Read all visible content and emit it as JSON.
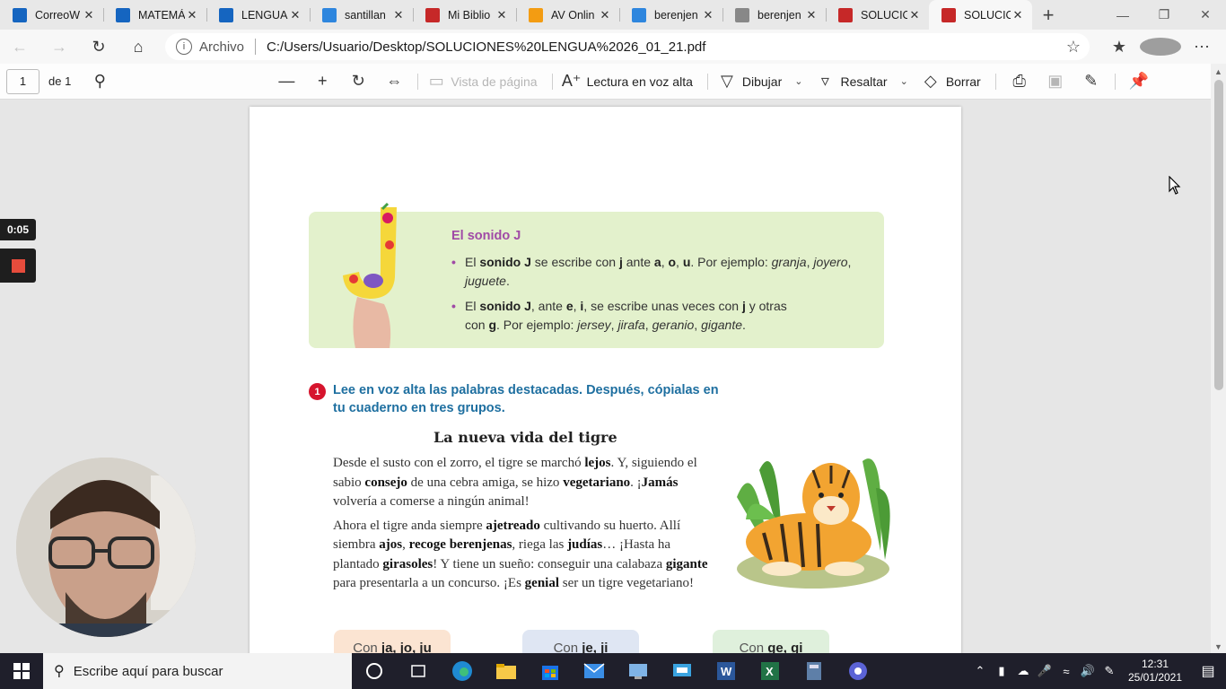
{
  "browser": {
    "tabs": [
      {
        "label": "CorreoW",
        "favicon": "mail-icon",
        "color": "#1565c0",
        "active": false
      },
      {
        "label": "MATEMÁ",
        "favicon": "book-icon",
        "color": "#1565c0",
        "active": false
      },
      {
        "label": "LENGUA",
        "favicon": "book-icon",
        "color": "#1565c0",
        "active": false
      },
      {
        "label": "santillan",
        "favicon": "bing-icon",
        "color": "#2e86de",
        "active": false
      },
      {
        "label": "Mi Biblio",
        "favicon": "e-icon",
        "color": "#c62828",
        "active": false
      },
      {
        "label": "AV Onlin",
        "favicon": "play-icon",
        "color": "#f39c12",
        "active": false
      },
      {
        "label": "berenjen",
        "favicon": "bing-icon",
        "color": "#2e86de",
        "active": false
      },
      {
        "label": "berenjen",
        "favicon": "y-icon",
        "color": "#888888",
        "active": false
      },
      {
        "label": "SOLUCIO",
        "favicon": "pdf-icon",
        "color": "#c62828",
        "active": false
      },
      {
        "label": "SOLUCIO",
        "favicon": "pdf-icon",
        "color": "#c62828",
        "active": true
      }
    ],
    "new_tab_symbol": "+",
    "address": {
      "scheme_label": "Archivo",
      "url": "C:/Users/Usuario/Desktop/SOLUCIONES%20LENGUA%2026_01_21.pdf"
    }
  },
  "pdf_toolbar": {
    "page_number": "1",
    "page_total": "de 1",
    "page_view": "Vista de página",
    "read_aloud": "Lectura en voz alta",
    "draw": "Dibujar",
    "highlight": "Resaltar",
    "erase": "Borrar"
  },
  "document": {
    "box_title": "El sonido J",
    "rule1": {
      "t1": "El ",
      "b1": "sonido J",
      "t2": " se escribe con ",
      "b2": "j",
      "t3": " ante ",
      "b3": "a",
      "t4": ", ",
      "b4": "o",
      "t5": ", ",
      "b5": "u",
      "t6": ". Por ejemplo: ",
      "i1": "granja",
      "t7": ", ",
      "i2": "joyero",
      "t8": ",",
      "i3": "juguete",
      "t9": "."
    },
    "rule2": {
      "t1": "El ",
      "b1": "sonido J",
      "t2": ", ante ",
      "b2": "e",
      "t3": ", ",
      "b3": "i",
      "t4": ", se escribe unas veces con ",
      "b4": "j",
      "t5": " y otras",
      "t6": "con ",
      "b5": "g",
      "t7": ". Por ejemplo: ",
      "i1": "jersey",
      "t8": ", ",
      "i2": "jirafa",
      "t9": ", ",
      "i3": "geranio",
      "t10": ", ",
      "i4": "gigante",
      "t11": "."
    },
    "exercise_number": "1",
    "exercise_text": "Lee en voz alta las palabras destacadas. Después, cópialas en tu cuaderno en tres grupos.",
    "story_title": "La nueva vida del tigre",
    "p1": {
      "t1": "Desde el susto con el zorro, el tigre se marchó ",
      "b1": "lejos",
      "t2": ". Y, siguiendo el sabio ",
      "b2": "consejo",
      "t3": " de una cebra amiga, se hizo ",
      "b3": "vegetariano",
      "t4": ". ¡",
      "b4": "Jamás",
      "t5": " volvería a comerse a ningún animal!"
    },
    "p2": {
      "t1": "Ahora el tigre anda siempre ",
      "b1": "ajetreado",
      "t2": " cultivando su huerto. Allí siembra ",
      "b2": "ajos",
      "t3": ", ",
      "b3": "recoge berenjenas",
      "t4": ", riega las ",
      "b4": "judías",
      "t5": "… ¡Hasta ha plantado ",
      "b5": "girasoles",
      "t6": "! Y tiene un sueño: conseguir una calabaza ",
      "b6": "gigante",
      "t7": " para presentarla a un concurso. ¡Es ",
      "b7": "genial",
      "t8": " ser un tigre vegetariano!"
    },
    "groups": [
      {
        "prefix": "Con ",
        "letters": "ja, jo, ju",
        "color": "#fbe4d2"
      },
      {
        "prefix": "Con ",
        "letters": "je, ji",
        "color": "#dfe6f3"
      },
      {
        "prefix": "Con ",
        "letters": "ge, gi",
        "color": "#dff0dc"
      }
    ]
  },
  "recording": {
    "elapsed": "0:05"
  },
  "taskbar": {
    "search_placeholder": "Escribe aquí para buscar",
    "time": "12:31",
    "date": "25/01/2021"
  }
}
